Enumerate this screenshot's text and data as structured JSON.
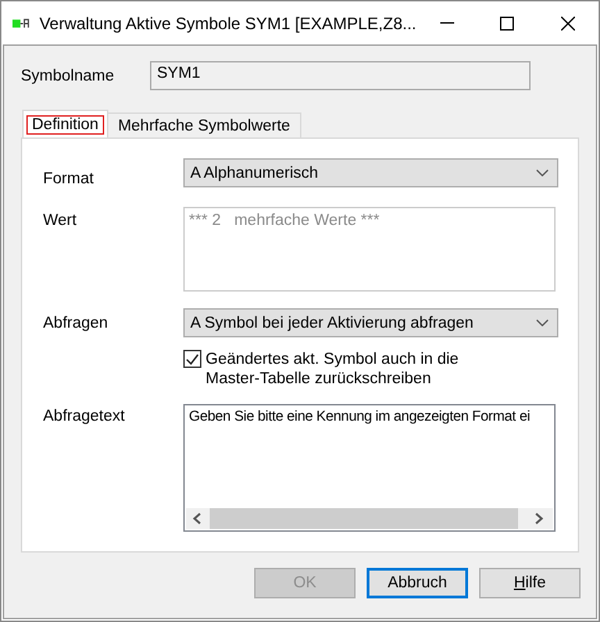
{
  "window": {
    "title": "Verwaltung Aktive Symbole SYM1 [EXAMPLE,Z8..."
  },
  "symbol_name": {
    "label": "Symbolname",
    "value": "SYM1"
  },
  "tabs": [
    {
      "label": "Definition",
      "selected": true
    },
    {
      "label": "Mehrfache Symbolwerte",
      "selected": false
    }
  ],
  "format": {
    "label": "Format",
    "value": "A Alphanumerisch"
  },
  "wert": {
    "label": "Wert",
    "value": "*** 2   mehrfache Werte ***",
    "disabled": true
  },
  "abfragen": {
    "label": "Abfragen",
    "value": "A Symbol bei jeder Aktivierung abfragen"
  },
  "writeback": {
    "label": "Geändertes akt. Symbol auch in die Master-Tabelle zurückschreiben",
    "checked": true
  },
  "abfragetext": {
    "label": "Abfragetext",
    "value": "Geben Sie bitte eine Kennung im angezeigten Format ei"
  },
  "buttons": [
    {
      "label": "OK",
      "disabled": true,
      "default": false,
      "mnemonic": false
    },
    {
      "label": "Abbruch",
      "disabled": false,
      "default": true,
      "mnemonic": false
    },
    {
      "label": "Hilfe",
      "disabled": false,
      "default": false,
      "mnemonic": true
    }
  ]
}
